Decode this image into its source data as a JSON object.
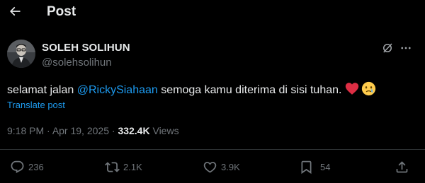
{
  "header": {
    "title": "Post",
    "back_icon": "arrow-left-icon"
  },
  "author": {
    "name": "SOLEH SOLIHUN",
    "handle": "@solehsolihun"
  },
  "tweet": {
    "text_before": "selamat jalan ",
    "mention": "@RickySiahaan",
    "text_after": " semoga kamu diterima di sisi tuhan.",
    "emojis": [
      "red-heart-icon",
      "crying-face-icon"
    ],
    "translate_label": "Translate post"
  },
  "meta": {
    "time": "9:18 PM",
    "separator": " · ",
    "date": "Apr 19, 2025",
    "views_count": "332.4K",
    "views_label": "Views"
  },
  "actions": {
    "replies": "236",
    "reposts": "2.1K",
    "likes": "3.9K",
    "bookmarks": "54"
  },
  "colors": {
    "background": "#000000",
    "text": "#e7e9ea",
    "secondary": "#71767b",
    "accent": "#1d9bf0",
    "divider": "#2f3336"
  }
}
